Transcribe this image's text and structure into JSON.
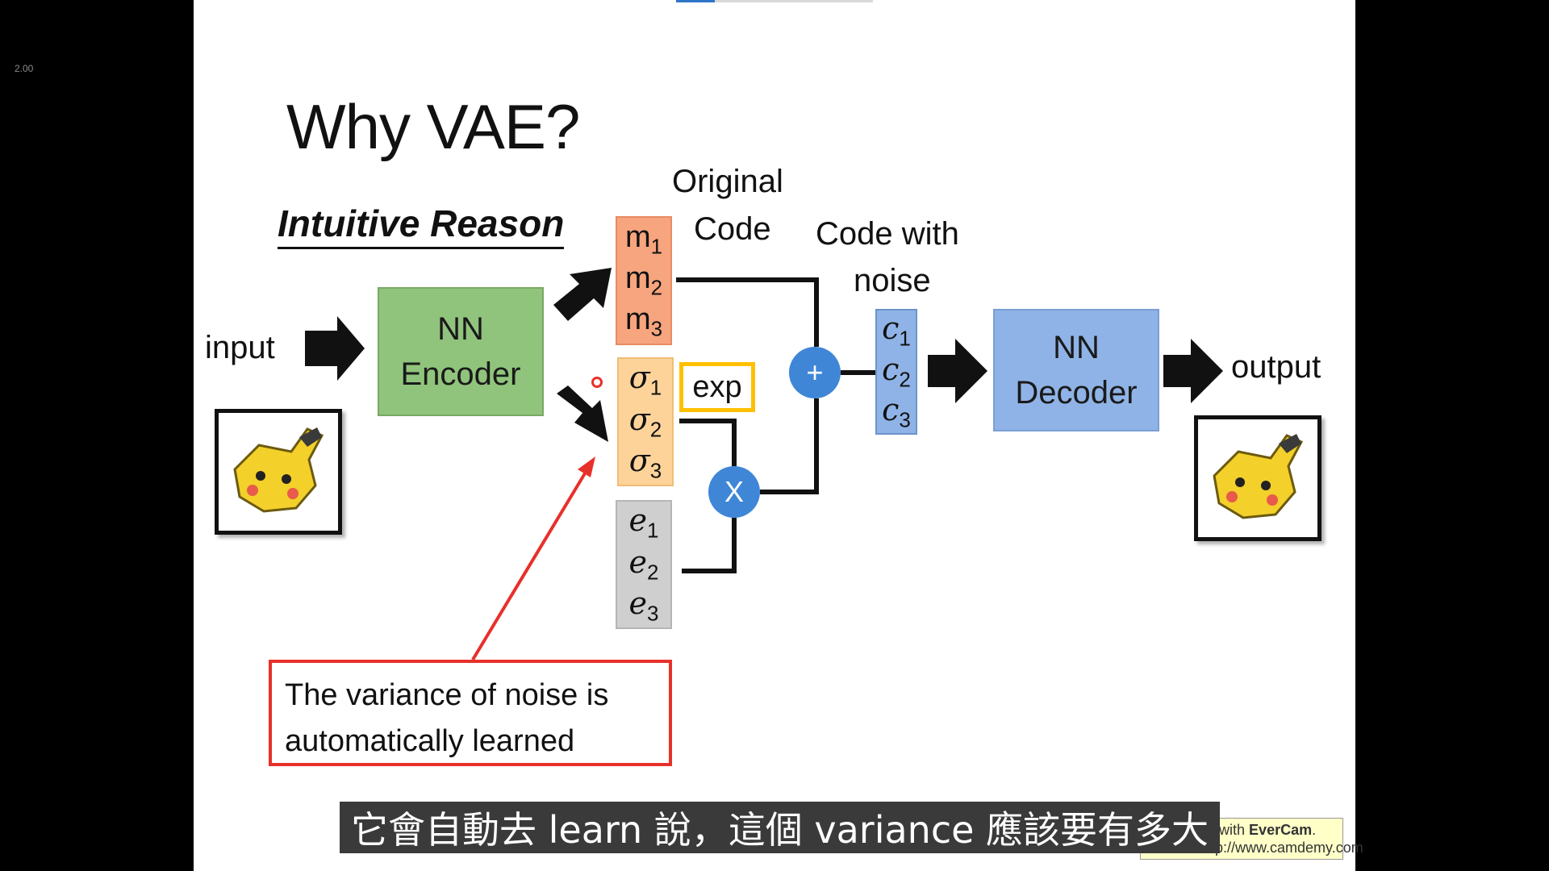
{
  "player": {
    "speed": "2.00"
  },
  "slide": {
    "title": "Why VAE?",
    "subtitle": "Intuitive Reason",
    "input_label": "input",
    "output_label": "output",
    "encoder": {
      "line1": "NN",
      "line2": "Encoder"
    },
    "decoder": {
      "line1": "NN",
      "line2": "Decoder"
    },
    "original_code": {
      "line1": "Original",
      "line2": "Code"
    },
    "code_with_noise": {
      "line1": "Code with",
      "line2": "noise"
    },
    "m_vector": [
      {
        "sym": "m",
        "idx": "1"
      },
      {
        "sym": "m",
        "idx": "2"
      },
      {
        "sym": "m",
        "idx": "3"
      }
    ],
    "sigma_vector": [
      {
        "sym": "σ",
        "idx": "1"
      },
      {
        "sym": "σ",
        "idx": "2"
      },
      {
        "sym": "σ",
        "idx": "3"
      }
    ],
    "e_vector": [
      {
        "sym": "e",
        "idx": "1"
      },
      {
        "sym": "e",
        "idx": "2"
      },
      {
        "sym": "e",
        "idx": "3"
      }
    ],
    "c_vector": [
      {
        "sym": "c",
        "idx": "1"
      },
      {
        "sym": "c",
        "idx": "2"
      },
      {
        "sym": "c",
        "idx": "3"
      }
    ],
    "exp_label": "exp",
    "plus_op": "+",
    "times_op": "X",
    "note": {
      "line1": "The variance of noise is",
      "line2": "automatically learned"
    },
    "colors": {
      "encoder": "#90c47c",
      "decoder": "#8fb3e6",
      "m_vector": "#f7a57e",
      "sigma_vector": "#fdd39a",
      "e_vector": "#cfcfcf",
      "operator": "#3f86d6",
      "note_border": "#e8302a",
      "exp_border": "#ffc000"
    }
  },
  "watermark": {
    "line1_prefix": "ed with ",
    "brand": "EverCam",
    "line1_suffix": ".",
    "line2": "http://www.camdemy.com"
  },
  "caption": "它會自動去 learn 說，這個 variance 應該要有多大"
}
